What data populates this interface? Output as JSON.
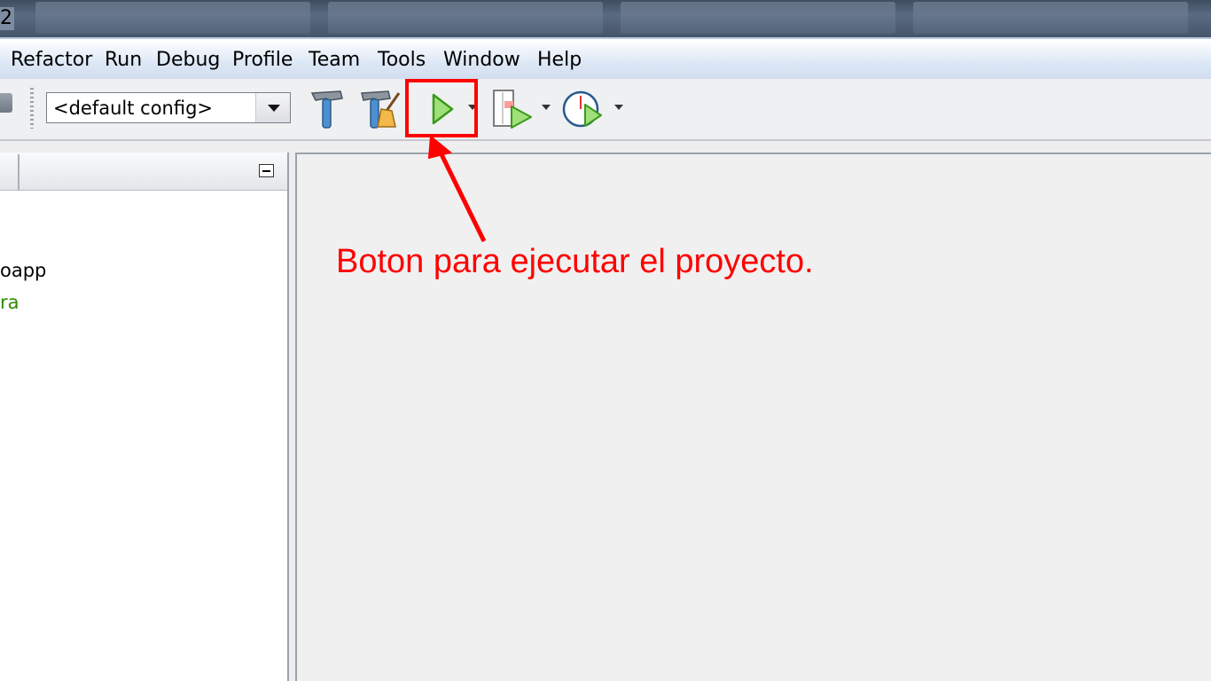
{
  "title_bar": {
    "title_fragment": "2"
  },
  "menu": {
    "items": [
      "Refactor",
      "Run",
      "Debug",
      "Profile",
      "Team",
      "Tools",
      "Window",
      "Help"
    ]
  },
  "toolbar": {
    "config_value": "<default config>",
    "icons": [
      "build-hammer-icon",
      "clean-build-icon",
      "run-project-icon",
      "debug-project-icon",
      "profile-project-icon"
    ]
  },
  "projects_panel": {
    "tree_items": [
      {
        "text": "oapp",
        "color": "#000000"
      },
      {
        "text": "ra",
        "color": "#2e8b00"
      }
    ]
  },
  "annotation": {
    "text": "Boton para ejecutar el proyecto.",
    "color": "#ff0000"
  }
}
